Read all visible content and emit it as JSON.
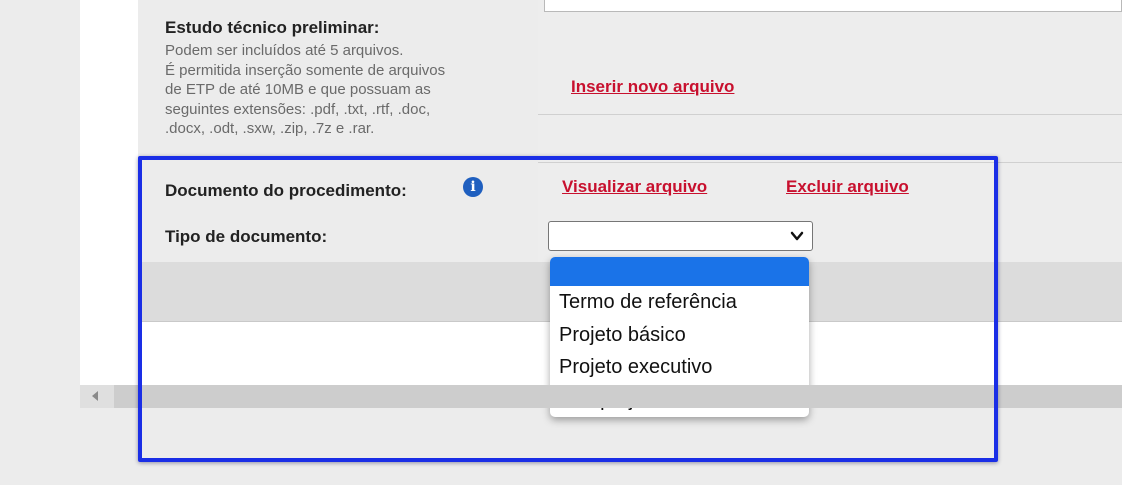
{
  "etp": {
    "title": "Estudo técnico preliminar:",
    "help_lines": [
      "Podem ser incluídos até 5 arquivos.",
      "É permitida inserção somente de arquivos",
      "de ETP de até 10MB e que possuam as",
      "seguintes extensões: .pdf, .txt, .rtf, .doc,",
      ".docx, .odt, .sxw, .zip, .7z e .rar."
    ],
    "insert_link": "Inserir novo arquivo"
  },
  "procedure_document": {
    "label": "Documento do procedimento:",
    "info_icon": "info-icon",
    "view_link": "Visualizar arquivo",
    "delete_link": "Excluir arquivo"
  },
  "document_type": {
    "label": "Tipo de documento:",
    "selected_value": "",
    "options": [
      "",
      "Termo de referência",
      "Projeto básico",
      "Projeto executivo",
      "Anteprojeto"
    ]
  },
  "colors": {
    "link": "#c8102e",
    "highlight_border": "#1a2ee6",
    "selected_option": "#1a73e8",
    "info_icon": "#1f5fbf"
  }
}
